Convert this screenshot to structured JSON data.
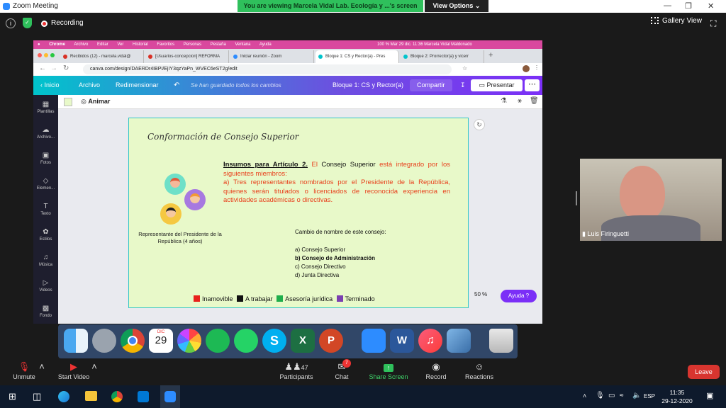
{
  "zoom": {
    "title": "Zoom Meeting",
    "banner": "You are viewing Marcela Vidal Lab. Ecología y ...'s screen",
    "view_options": "View Options",
    "recording": "Recording",
    "gallery_view": "Gallery View",
    "participant_name": "Luis Firinguetti",
    "controls": {
      "unmute": "Unmute",
      "start_video": "Start Video",
      "participants": "Participants",
      "participants_count": "47",
      "chat": "Chat",
      "chat_badge": "7",
      "share_screen": "Share Screen",
      "record": "Record",
      "reactions": "Reactions",
      "leave": "Leave"
    }
  },
  "mac": {
    "menu": [
      "Chrome",
      "Archivo",
      "Editar",
      "Ver",
      "Historial",
      "Favoritos",
      "Personas",
      "Pestaña",
      "Ventana",
      "Ayuda"
    ],
    "status": "100 %   Mar 29 dic.  11:36   Marcela Vidal Maldonado"
  },
  "browser": {
    "tabs": [
      {
        "label": "Recibidos (12) - marcela.vidal@",
        "color": "#d93025"
      },
      {
        "label": "[Usuarios-concepcion] REFORMA",
        "color": "#d93025"
      },
      {
        "label": "Iniciar reunión - Zoom",
        "color": "#2d8cff"
      },
      {
        "label": "Bloque 1: CS y Rector(a) - Pres",
        "color": "#00c4cc"
      },
      {
        "label": "Bloque 2: Prorrector(a) y vicerr",
        "color": "#00c4cc"
      }
    ],
    "url": "canva.com/design/DAERDr4IBPI/EjIY3qzYaPn_WVEC6eST2g/edit"
  },
  "canva": {
    "inicio": "Inicio",
    "archivo": "Archivo",
    "redimensionar": "Redimensionar",
    "saved": "Se han guardado todos los cambios",
    "doc_title": "Bloque 1: CS y Rector(a)",
    "compartir": "Compartir",
    "presentar": "Presentar",
    "animar": "Animar",
    "zoom_pct": "50 %",
    "ayuda": "Ayuda ?",
    "sidebar": [
      "Plantillas",
      "Archivo...",
      "Fotos",
      "Elemen...",
      "Texto",
      "Estilos",
      "Música",
      "Videos",
      "Fondo"
    ]
  },
  "slide": {
    "title": "Conformación de Consejo Superior",
    "heading": "Insumos para Artículo 2.",
    "p1_a": " El ",
    "p1_b": "Consejo Superior",
    "p1_c": " está integrado por los siguientes miembros:",
    "p2": "a) Tres representantes nombrados por el Presidente de la República, quienes serán titulados o licenciados de reconocida experiencia en actividades académicas o directivas.",
    "rep_label": "Representante del Presidente de la República (4 años)",
    "cambio": "Cambio de nombre de este consejo:",
    "options": [
      "a) Consejo Superior",
      "b) Consejo de Administración",
      "c) Consejo Directivo",
      "d) Junta Directiva"
    ],
    "legend": [
      {
        "label": "Inamovible",
        "color": "#e8221c"
      },
      {
        "label": "A trabajar",
        "color": "#111111"
      },
      {
        "label": "Asesoría jurídica",
        "color": "#1fae4b"
      },
      {
        "label": "Terminado",
        "color": "#7b3fb0"
      }
    ]
  },
  "dock": {
    "calendar_month": "DIC",
    "calendar_day": "29"
  },
  "taskbar": {
    "lang": "ESP",
    "time": "11:35",
    "date": "29-12-2020"
  }
}
